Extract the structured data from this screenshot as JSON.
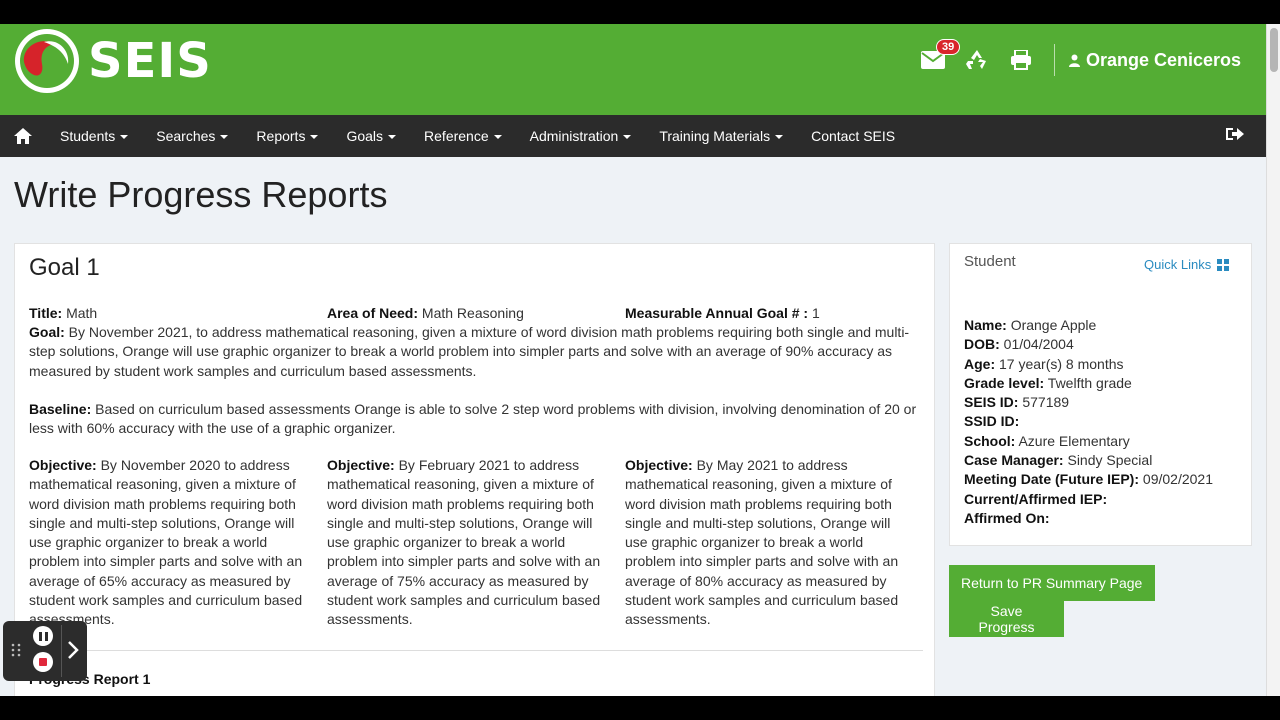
{
  "header": {
    "logo_text": "SEIS",
    "mail_badge": "39",
    "user_name": "Orange Ceniceros"
  },
  "nav": {
    "items": [
      "Students",
      "Searches",
      "Reports",
      "Goals",
      "Reference",
      "Administration",
      "Training Materials"
    ],
    "contact": "Contact SEIS"
  },
  "page": {
    "title": "Write Progress Reports"
  },
  "goal": {
    "heading": "Goal 1",
    "title_label": "Title:",
    "title_value": "Math",
    "area_label": "Area of Need:",
    "area_value": "Math Reasoning",
    "mag_label": "Measurable Annual Goal # :",
    "mag_value": "1",
    "goal_label": "Goal:",
    "goal_text": "By November 2021, to address mathematical reasoning, given a mixture of word division math problems requiring both single and multi-step solutions, Orange will use graphic organizer to break a world problem into simpler parts and solve with an average of 90% accuracy as measured by student work samples and curriculum based assessments.",
    "baseline_label": "Baseline:",
    "baseline_text": "Based on curriculum based assessments Orange is able to solve 2 step word problems with division, involving denomination of 20 or less with 60% accuracy with the use of a graphic organizer.",
    "objective_label": "Objective:",
    "objectives": [
      "By November 2020 to address mathematical reasoning, given a mixture of word division math problems requiring both single and multi-step solutions, Orange will use graphic organizer to break a world problem into simpler parts and solve with an average of 65% accuracy as measured by student work samples and curriculum based assessments.",
      "By February 2021 to address mathematical reasoning, given a mixture of word division math problems requiring both single and multi-step solutions, Orange will use graphic organizer to break a world problem into simpler parts and solve with an average of 75% accuracy as measured by student work samples and curriculum based assessments.",
      "By May 2021 to address mathematical reasoning, given a mixture of word division math problems requiring both single and multi-step solutions, Orange will use graphic organizer to break a world problem into simpler parts and solve with an average of 80% accuracy as measured by student work samples and curriculum based assessments."
    ],
    "progress_report_label": "Progress Report 1"
  },
  "student": {
    "panel_title": "Student",
    "quick_links": "Quick Links",
    "fields": [
      {
        "label": "Name:",
        "value": "Orange Apple"
      },
      {
        "label": "DOB:",
        "value": "01/04/2004"
      },
      {
        "label": "Age:",
        "value": "17 year(s) 8 months"
      },
      {
        "label": "Grade level:",
        "value": "Twelfth grade"
      },
      {
        "label": "SEIS ID:",
        "value": "577189"
      },
      {
        "label": "SSID ID:",
        "value": ""
      },
      {
        "label": "School:",
        "value": "Azure Elementary"
      },
      {
        "label": "Case Manager:",
        "value": "Sindy Special"
      },
      {
        "label": "Meeting Date (Future IEP):",
        "value": "09/02/2021"
      },
      {
        "label": "Current/Affirmed IEP:",
        "value": ""
      },
      {
        "label": "Affirmed On:",
        "value": ""
      }
    ]
  },
  "actions": {
    "return_label": "Return to PR Summary Page",
    "save_label": "Save Progress"
  },
  "colors": {
    "brand_green": "#54ad34",
    "nav_dark": "#2b2b2b",
    "link_blue": "#2a8bc0",
    "badge_red": "#d9252b"
  }
}
